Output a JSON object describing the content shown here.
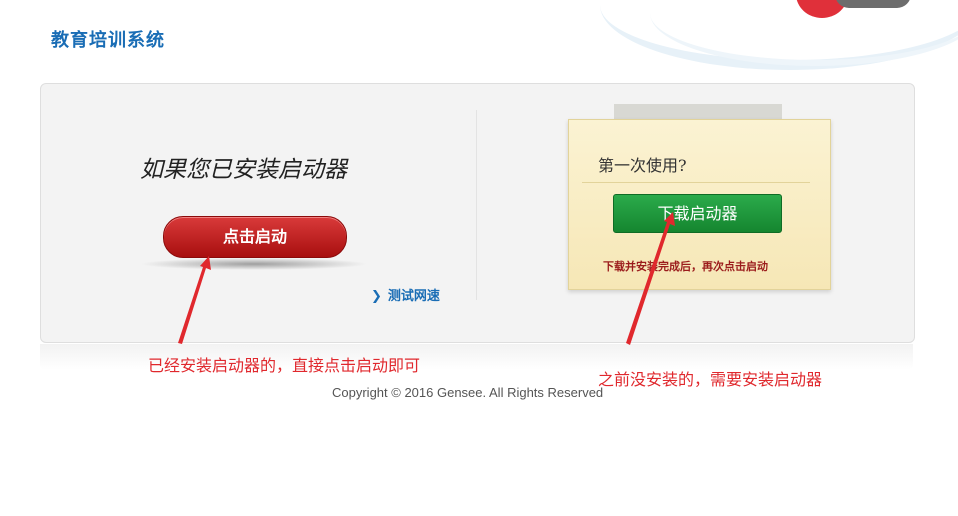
{
  "header": {
    "title": "教育培训系统"
  },
  "left_panel": {
    "heading": "如果您已安装启动器",
    "start_button_label": "点击启动",
    "speed_test_link": "测试网速"
  },
  "right_panel": {
    "note_title": "第一次使用?",
    "download_button_label": "下载启动器",
    "hint": "下载并安装完成后，再次点击启动"
  },
  "annotations": {
    "left": "已经安装启动器的，直接点击启动即可",
    "right": "之前没安装的，需要安装启动器"
  },
  "footer": {
    "copyright": "Copyright © 2016 Gensee. All Rights Reserved"
  },
  "colors": {
    "brand_blue": "#1a6db5",
    "start_red": "#c62828",
    "download_green": "#1f9a3d",
    "annotation_red": "#e0282d"
  },
  "icons": [
    "chevron-right-icon"
  ]
}
